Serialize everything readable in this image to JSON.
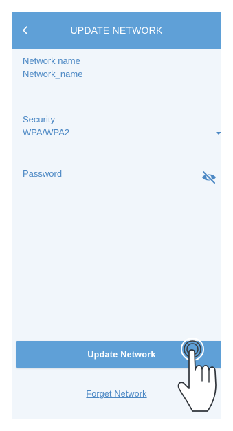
{
  "header": {
    "title": "UPDATE NETWORK",
    "back_icon": "chevron-left-icon"
  },
  "form": {
    "network_name": {
      "label": "Network name",
      "value": "Network_name"
    },
    "security": {
      "label": "Security",
      "selected": "WPA/WPA2",
      "icon": "dropdown-caret-icon"
    },
    "password": {
      "placeholder": "Password",
      "icon": "eye-off-icon"
    }
  },
  "actions": {
    "update_label": "Update Network",
    "forget_label": "Forget Network"
  },
  "overlay": {
    "icon": "tap-gesture-hand-icon"
  },
  "colors": {
    "accent": "#5fa0d7",
    "text_accent": "#4c88c4",
    "background": "#f1f6fb",
    "divider": "#9dbcd8"
  }
}
